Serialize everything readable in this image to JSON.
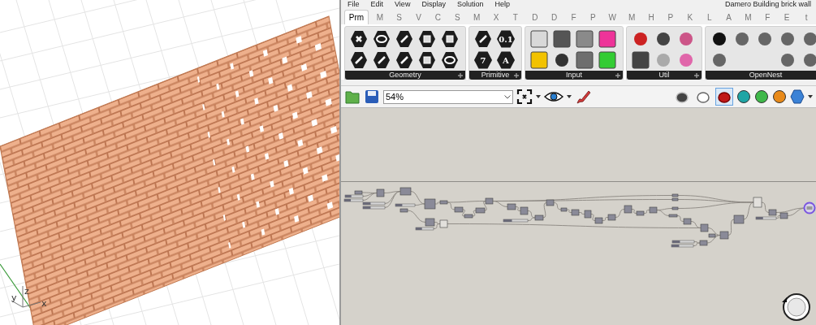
{
  "window": {
    "title": "Damero Building brick wall"
  },
  "menu": [
    "File",
    "Edit",
    "View",
    "Display",
    "Solution",
    "Help"
  ],
  "tabs": [
    {
      "label": "Prm",
      "selected": true
    },
    {
      "label": "M",
      "selected": false
    },
    {
      "label": "S",
      "selected": false
    },
    {
      "label": "V",
      "selected": false
    },
    {
      "label": "C",
      "selected": false
    },
    {
      "label": "S",
      "selected": false
    },
    {
      "label": "M",
      "selected": false
    },
    {
      "label": "X",
      "selected": false
    },
    {
      "label": "T",
      "selected": false
    },
    {
      "label": "D",
      "selected": false
    },
    {
      "label": "D",
      "selected": false
    },
    {
      "label": "F",
      "selected": false
    },
    {
      "label": "P",
      "selected": false
    },
    {
      "label": "W",
      "selected": false
    },
    {
      "label": "M",
      "selected": false
    },
    {
      "label": "H",
      "selected": false
    },
    {
      "label": "P",
      "selected": false
    },
    {
      "label": "K",
      "selected": false
    },
    {
      "label": "L",
      "selected": false
    },
    {
      "label": "A",
      "selected": false
    },
    {
      "label": "M",
      "selected": false
    },
    {
      "label": "F",
      "selected": false
    },
    {
      "label": "E",
      "selected": false
    },
    {
      "label": "t",
      "selected": false
    }
  ],
  "ribbon_groups": [
    {
      "label": "Geometry",
      "icons": [
        {
          "kind": "hex"
        },
        {
          "kind": "hex"
        },
        {
          "kind": "hex"
        },
        {
          "kind": "hex"
        },
        {
          "kind": "hex"
        },
        {
          "kind": "hex"
        },
        {
          "kind": "hex"
        },
        {
          "kind": "hex"
        },
        {
          "kind": "hex"
        },
        {
          "kind": "hex"
        }
      ]
    },
    {
      "label": "Primitive",
      "icons": [
        {
          "kind": "hex"
        },
        {
          "kind": "hex",
          "glyph": "7"
        },
        {
          "kind": "hex",
          "glyph": "0.1"
        },
        {
          "kind": "hex",
          "glyph": "A"
        }
      ]
    },
    {
      "label": "Input",
      "icons": [
        {
          "kind": "tile",
          "color": "#d8d8d8"
        },
        {
          "kind": "tile",
          "color": "#f2c200"
        },
        {
          "kind": "tile",
          "color": "#555555"
        },
        {
          "kind": "symbol",
          "color": "#333333"
        },
        {
          "kind": "tile",
          "color": "#8a8a8a"
        },
        {
          "kind": "tile",
          "color": "#6e6e6e"
        },
        {
          "kind": "tile",
          "color": "#ee3399"
        },
        {
          "kind": "tile",
          "color": "#33cc33"
        }
      ]
    },
    {
      "label": "Util",
      "icons": [
        {
          "kind": "symbol",
          "color": "#cc2222"
        },
        {
          "kind": "tile",
          "color": "#444444"
        },
        {
          "kind": "symbol",
          "color": "#444444"
        },
        {
          "kind": "symbol",
          "color": "#aaaaaa"
        },
        {
          "kind": "symbol",
          "color": "#cc5588"
        },
        {
          "kind": "symbol",
          "color": "#e066aa"
        }
      ]
    },
    {
      "label": "OpenNest",
      "icons": [
        {
          "kind": "symbol",
          "color": "#111111"
        },
        {
          "kind": "symbol",
          "color": "#666666"
        },
        {
          "kind": "symbol",
          "color": "#666666"
        },
        {
          "kind": "blank"
        },
        {
          "kind": "symbol",
          "color": "#666666"
        },
        {
          "kind": "blank"
        },
        {
          "kind": "symbol",
          "color": "#666666"
        },
        {
          "kind": "symbol",
          "color": "#666666"
        },
        {
          "kind": "symbol",
          "color": "#666666"
        },
        {
          "kind": "symbol",
          "color": "#666666"
        }
      ]
    }
  ],
  "toolbar": {
    "zoom": "54%",
    "preview_buttons": [
      {
        "selected": false
      },
      {
        "selected": false
      },
      {
        "selected": true
      }
    ]
  },
  "viewport": {
    "axes": [
      "z",
      "y",
      "x"
    ]
  }
}
